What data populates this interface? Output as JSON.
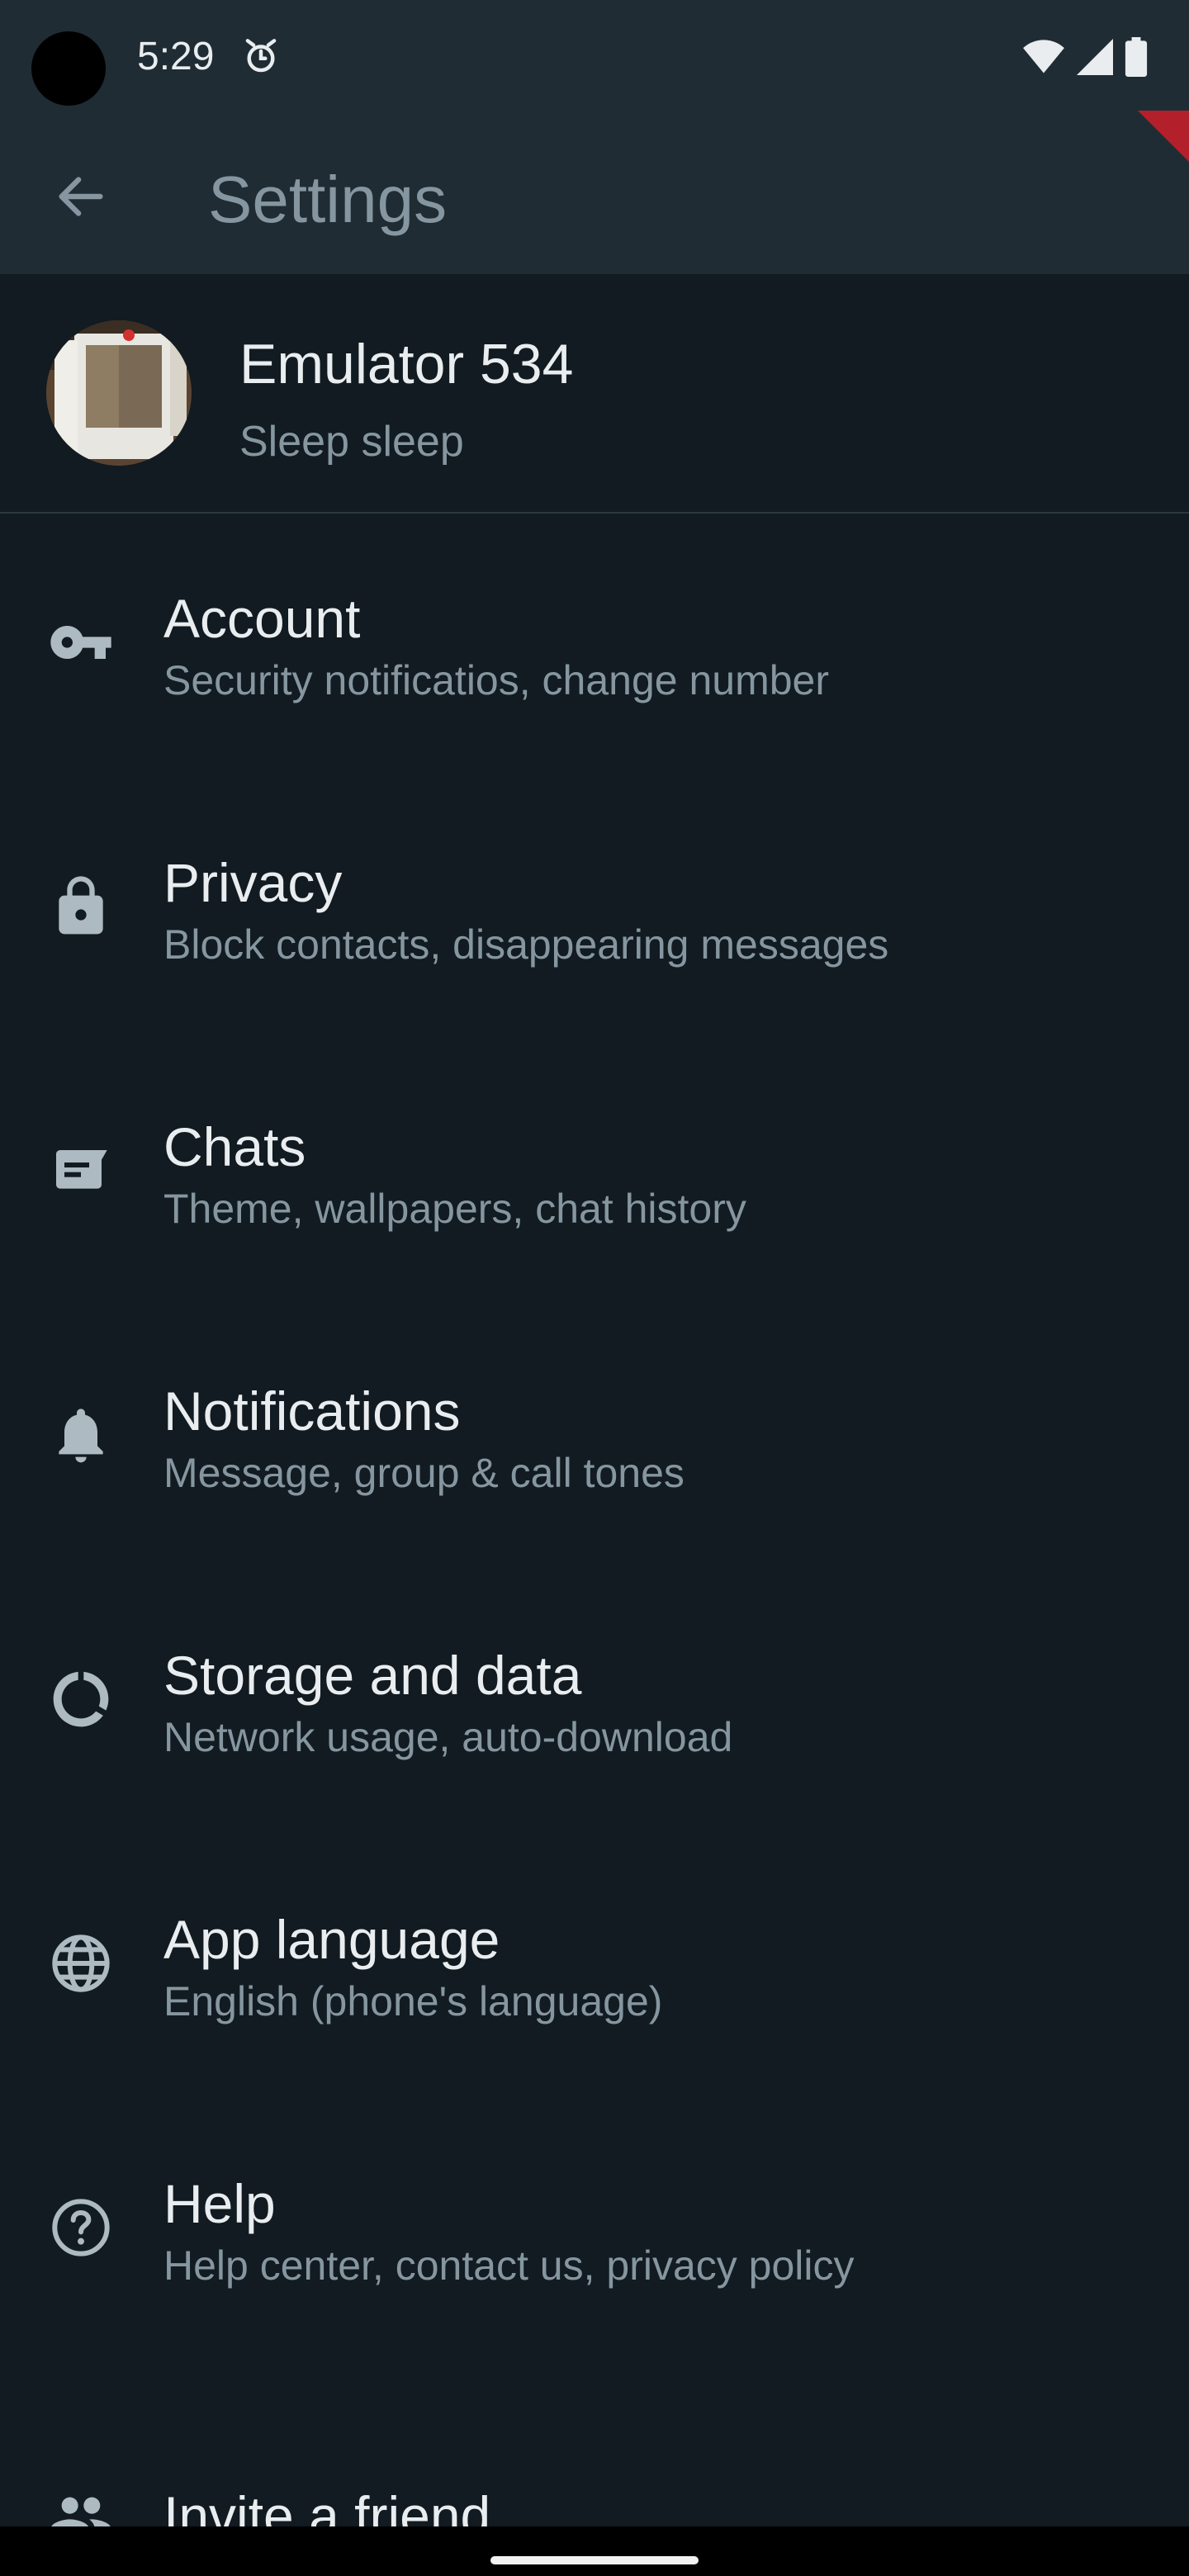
{
  "status_bar": {
    "time": "5:29",
    "icons": [
      "alarm-icon",
      "wifi-icon",
      "signal-icon",
      "battery-icon"
    ]
  },
  "app_bar": {
    "title": "Settings",
    "back_icon": "arrow-left-icon"
  },
  "profile": {
    "name": "Emulator 534",
    "status": "Sleep sleep",
    "avatar": "profile-photo"
  },
  "settings": {
    "items": [
      {
        "icon": "key-icon",
        "title": "Account",
        "subtitle": "Security notificatios, change number"
      },
      {
        "icon": "lock-icon",
        "title": "Privacy",
        "subtitle": "Block contacts, disappearing messages"
      },
      {
        "icon": "chat-icon",
        "title": "Chats",
        "subtitle": "Theme, wallpapers, chat history"
      },
      {
        "icon": "bell-icon",
        "title": "Notifications",
        "subtitle": "Message, group & call tones"
      },
      {
        "icon": "data-usage-icon",
        "title": "Storage and data",
        "subtitle": "Network usage, auto-download"
      },
      {
        "icon": "globe-icon",
        "title": "App language",
        "subtitle": "English (phone's language)"
      },
      {
        "icon": "help-icon",
        "title": "Help",
        "subtitle": "Help center, contact us, privacy policy"
      },
      {
        "icon": "people-icon",
        "title": "Invite a friend",
        "subtitle": ""
      }
    ]
  },
  "colors": {
    "background": "#111b21",
    "app_bar": "#1f2c34",
    "primary_text": "#e9edef",
    "secondary_text": "#8696a0",
    "icon": "#aebac1"
  }
}
